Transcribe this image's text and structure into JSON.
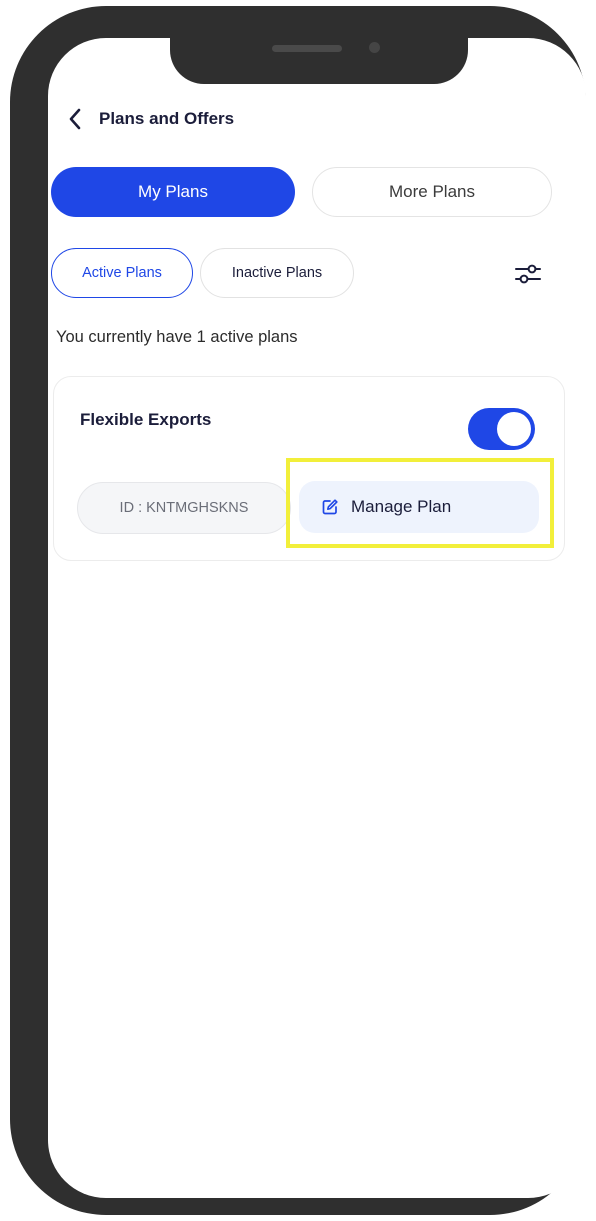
{
  "header": {
    "back_icon": "chevron-left-icon",
    "title": "Plans and Offers"
  },
  "segment": {
    "my_plans_label": "My Plans",
    "more_plans_label": "More Plans",
    "selected": "My Plans"
  },
  "filters": {
    "active_label": "Active Plans",
    "inactive_label": "Inactive Plans",
    "selected": "Active Plans",
    "filter_icon": "sliders-icon"
  },
  "summary_text": "You currently have 1 active plans",
  "plan_card": {
    "name": "Flexible Exports",
    "enabled": true,
    "id_text": "ID : KNTMGHSKNS",
    "manage_label": "Manage Plan",
    "manage_icon": "edit-icon"
  },
  "colors": {
    "accent": "#1f47e6",
    "highlight": "#f2ef3a",
    "phone_frame": "#2f2f2f"
  }
}
